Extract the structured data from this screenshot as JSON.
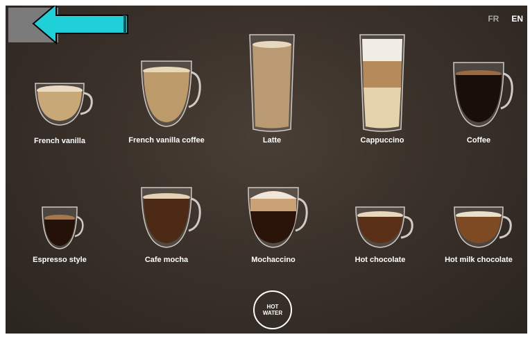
{
  "language": {
    "options": [
      "FR",
      "EN"
    ],
    "selected": "EN"
  },
  "back_icon": "left-arrow-icon",
  "drinks_row1": [
    {
      "label": "French vanilla",
      "style": "cup"
    },
    {
      "label": "French vanilla coffee",
      "style": "mug"
    },
    {
      "label": "Latte",
      "style": "tall"
    },
    {
      "label": "Cappuccino",
      "style": "tall-layered"
    },
    {
      "label": "Coffee",
      "style": "mug-dark"
    }
  ],
  "drinks_row2": [
    {
      "label": "Espresso style",
      "style": "small-cup"
    },
    {
      "label": "Cafe mocha",
      "style": "mug"
    },
    {
      "label": "Mochaccino",
      "style": "mug-foam"
    },
    {
      "label": "Hot chocolate",
      "style": "cup"
    },
    {
      "label": "Hot milk chocolate",
      "style": "cup"
    }
  ],
  "hot_water": {
    "line1": "HOT",
    "line2": "WATER"
  },
  "colors": {
    "background": "#3a312a",
    "arrow": "#1fd0d8",
    "back_block": "#7b7b7b",
    "text": "#ffffff"
  }
}
